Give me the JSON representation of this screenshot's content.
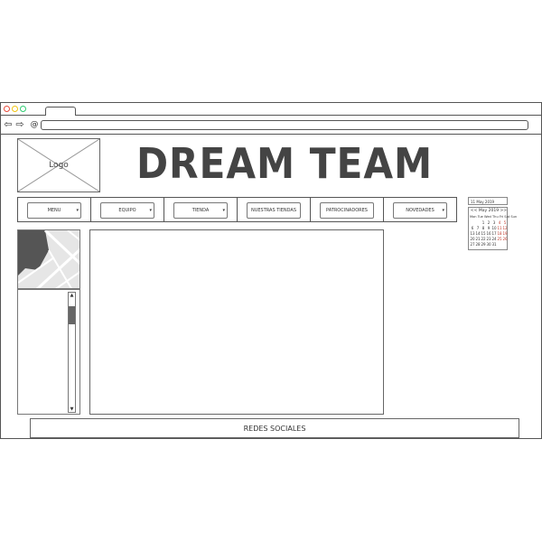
{
  "site": {
    "title": "DREAM TEAM",
    "logo_label": "Logo"
  },
  "menu": {
    "items": [
      {
        "label": "MENU"
      },
      {
        "label": "EQUIPO"
      },
      {
        "label": "TIENDA"
      },
      {
        "label": "NUESTRAS TIENDAS"
      },
      {
        "label": "PATROCINADORES"
      },
      {
        "label": "NOVEDADES"
      }
    ]
  },
  "calendar": {
    "date_field": "11 May 2019",
    "header": "<< May 2019 >>",
    "weekdays": "Mon Tue Wed Thu Fri Sat Sun",
    "days": [
      "",
      "",
      "1",
      "2",
      "3",
      "4",
      "5",
      "6",
      "7",
      "8",
      "9",
      "10",
      "11",
      "12",
      "13",
      "14",
      "15",
      "16",
      "17",
      "18",
      "19",
      "20",
      "21",
      "22",
      "23",
      "24",
      "25",
      "26",
      "27",
      "28",
      "29",
      "30",
      "31",
      "",
      ""
    ]
  },
  "footer": {
    "label": "REDES SOCIALES"
  },
  "icons": {
    "back": "arrow-left-icon",
    "forward": "arrow-right-icon",
    "reload": "at-icon",
    "scroll_up": "triangle-up",
    "scroll_down": "triangle-down"
  },
  "colors": {
    "close": "#e74c3c",
    "minimize": "#f1c40f",
    "maximize": "#2ecc71",
    "weekend": "#c0392b"
  }
}
